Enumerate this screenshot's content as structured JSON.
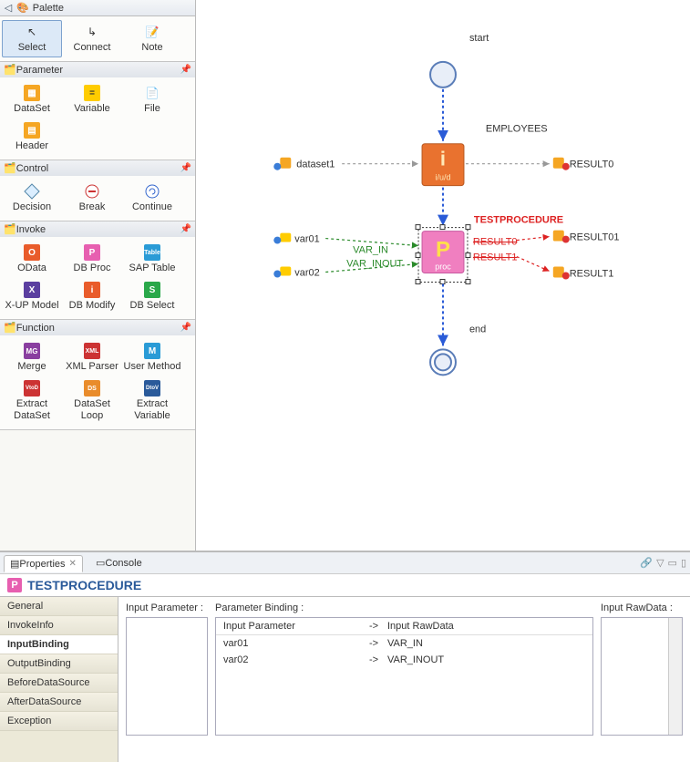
{
  "palette": {
    "title": "Palette",
    "sections": {
      "tools": {
        "select": "Select",
        "connect": "Connect",
        "note": "Note"
      },
      "parameter": {
        "header": "Parameter",
        "dataset": "DataSet",
        "variable": "Variable",
        "file": "File",
        "header_item": "Header"
      },
      "control": {
        "header": "Control",
        "decision": "Decision",
        "break": "Break",
        "continue": "Continue"
      },
      "invoke": {
        "header": "Invoke",
        "odata": "OData",
        "dbproc": "DB Proc",
        "saptable": "SAP Table",
        "xupmodel": "X-UP Model",
        "dbmodify": "DB Modify",
        "dbselect": "DB Select"
      },
      "function": {
        "header": "Function",
        "merge": "Merge",
        "xmlparser": "XML Parser",
        "usermethod": "User Method",
        "extractds": "Extract DataSet",
        "dsloop": "DataSet Loop",
        "extractvar": "Extract Variable"
      }
    }
  },
  "canvas": {
    "start": "start",
    "end": "end",
    "dataset1": "dataset1",
    "employees": "EMPLOYEES",
    "iud": "i/u/d",
    "result0": "RESULT0",
    "testprocedure": "TESTPROCEDURE",
    "proc": "proc",
    "var01": "var01",
    "var02": "var02",
    "var_in": "VAR_IN",
    "var_inout": "VAR_INOUT",
    "result0s": "RESULT0",
    "result1s": "RESULT1",
    "result01": "RESULT01",
    "result1": "RESULT1"
  },
  "tabs": {
    "properties": "Properties",
    "console": "Console"
  },
  "prop": {
    "title": "TESTPROCEDURE",
    "nav": {
      "general": "General",
      "invokeinfo": "InvokeInfo",
      "inputbinding": "InputBinding",
      "outputbinding": "OutputBinding",
      "beforeds": "BeforeDataSource",
      "afterds": "AfterDataSource",
      "exception": "Exception"
    },
    "inputparam_hdr": "Input Parameter :",
    "parambinding_hdr": "Parameter Binding :",
    "inputraw_hdr": "Input RawData :",
    "tbl": {
      "col1": "Input Parameter",
      "arrow": "->",
      "col2": "Input RawData",
      "r1c1": "var01",
      "r1c2": "VAR_IN",
      "r2c1": "var02",
      "r2c2": "VAR_INOUT"
    }
  }
}
